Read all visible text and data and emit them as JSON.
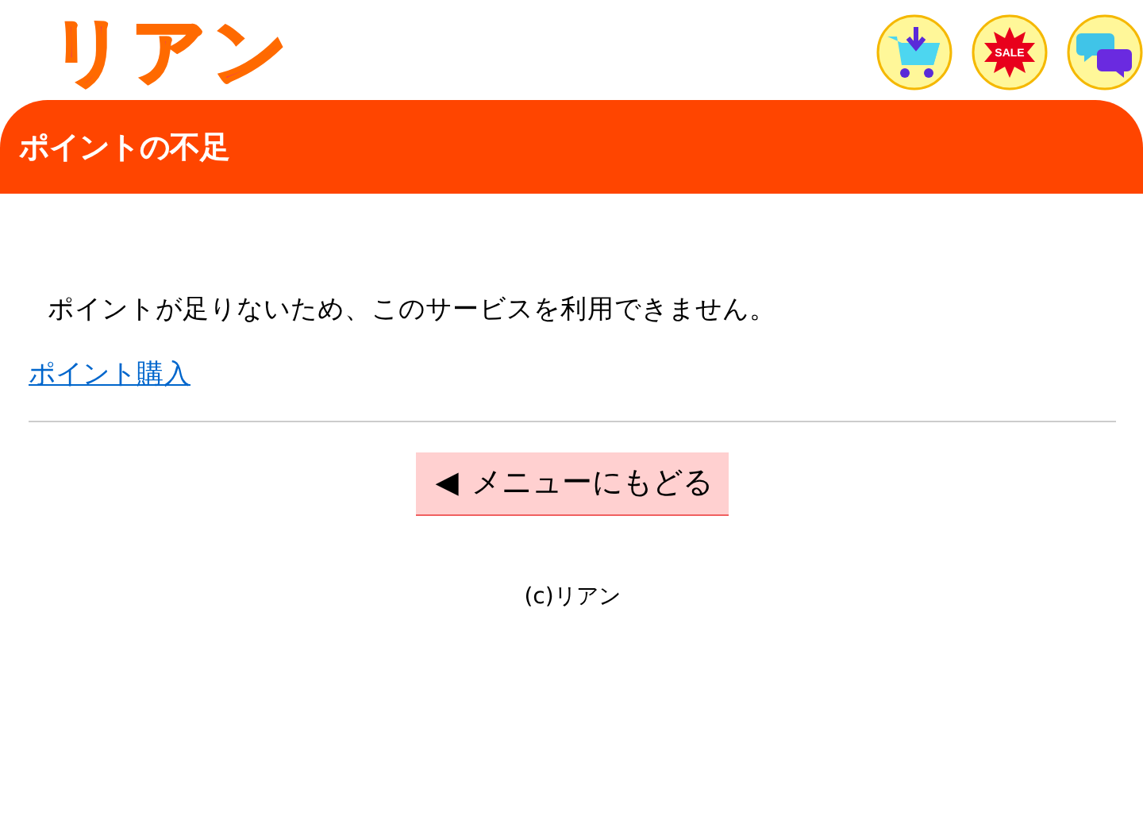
{
  "logo": {
    "text": "リアン"
  },
  "header_icons": [
    {
      "kind": "cart"
    },
    {
      "kind": "sale",
      "text": "SALE"
    },
    {
      "kind": "chat"
    }
  ],
  "title_bar": {
    "title": "ポイントの不足"
  },
  "message": "ポイントが足りないため、このサービスを利用できません。",
  "link": "ポイント購入",
  "back_button": {
    "icon": "◀",
    "label": "メニューにもどる"
  },
  "footer": "(c)リアン"
}
